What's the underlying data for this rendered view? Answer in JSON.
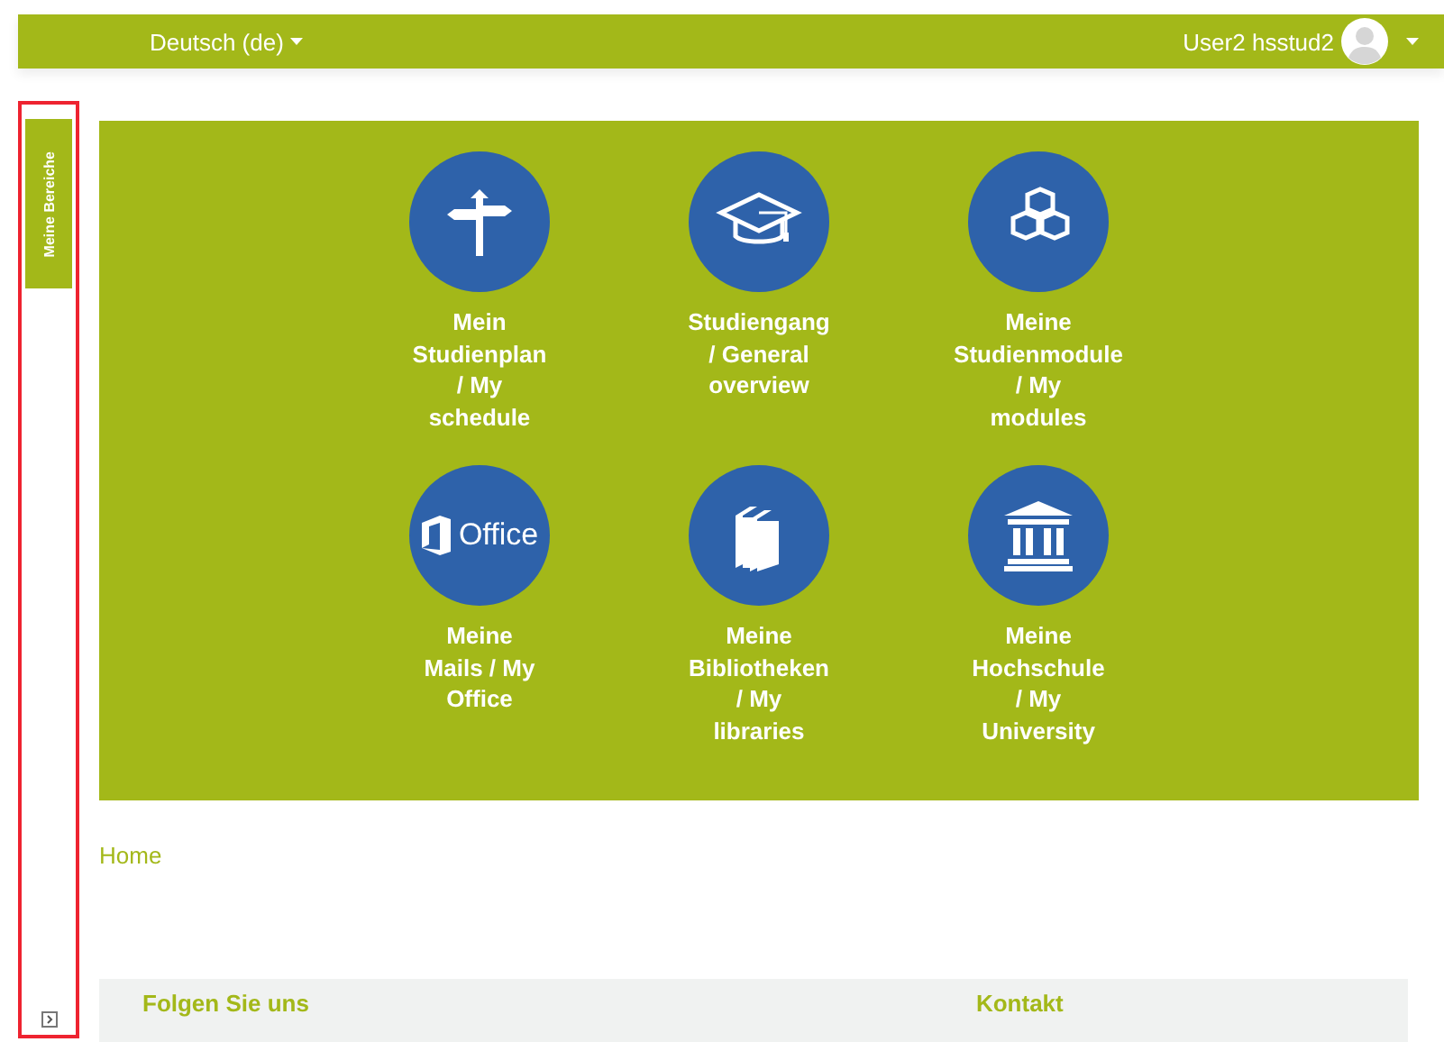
{
  "top_bar": {
    "language": "Deutsch (de)",
    "user": "User2 hsstud2"
  },
  "sidebar": {
    "tab": "Meine Bereiche",
    "highlighted": true
  },
  "tiles": [
    {
      "kind": "signpost",
      "label": "Mein\nStudienplan\n/ My\nschedule"
    },
    {
      "kind": "graduation-cap",
      "label": "Studiengang\n/ General\noverview"
    },
    {
      "kind": "cubes",
      "label": "Meine\nStudienmodule\n/ My\nmodules"
    },
    {
      "kind": "office",
      "icon_text": "Office",
      "label": "Meine\nMails / My\nOffice"
    },
    {
      "kind": "books",
      "label": "Meine\nBibliotheken\n/ My\nlibraries"
    },
    {
      "kind": "building",
      "label": "Meine\nHochschule\n/ My\nUniversity"
    }
  ],
  "breadcrumb": "Home",
  "footer": {
    "headings": [
      "Folgen Sie uns",
      "Kontakt"
    ]
  }
}
